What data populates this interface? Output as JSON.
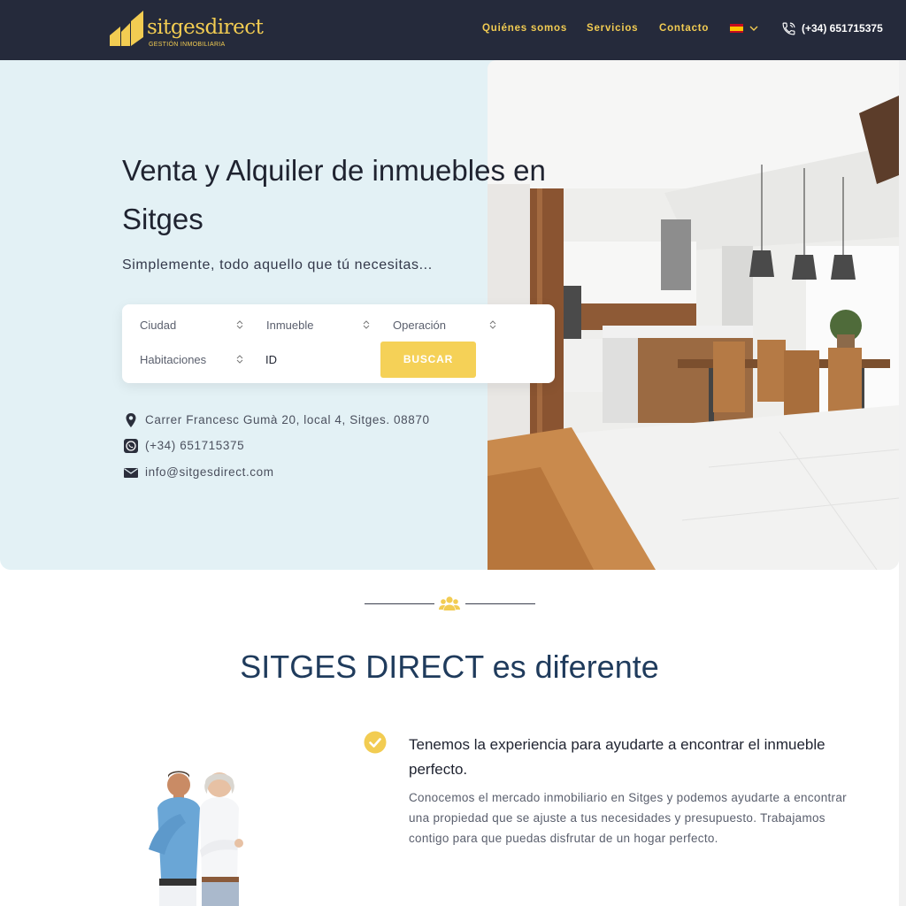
{
  "brand": {
    "name": "sitgesdirect",
    "tagline": "GESTIÓN INMOBILIARIA",
    "accent": "#f2cc52",
    "header_bg": "#252a3b"
  },
  "nav": {
    "items": [
      {
        "label": "Quiénes somos"
      },
      {
        "label": "Servicios"
      },
      {
        "label": "Contacto"
      }
    ],
    "language_icon": "flag-spain-icon",
    "phone": "(+34) 651715375"
  },
  "hero": {
    "title": "Venta y Alquiler de inmuebles en Sitges",
    "subtitle": "Simplemente, todo aquello que tú necesitas...",
    "search": {
      "city": "Ciudad",
      "property": "Inmueble",
      "operation": "Operación",
      "rooms": "Habitaciones",
      "id_placeholder": "ID",
      "button": "BUSCAR"
    },
    "contact": {
      "address": "Carrer Francesc Gumà 20, local 4, Sitges. 08870",
      "phone": "(+34) 651715375",
      "email": "info@sitgesdirect.com"
    }
  },
  "section": {
    "title_strong": "SITGES DIRECT",
    "title_rest": " es diferente",
    "feature": {
      "title": "Tenemos la experiencia para ayudarte a encontrar el inmueble perfecto.",
      "body": "Conocemos el mercado inmobiliario en Sitges y podemos ayudarte a encontrar una propiedad que se ajuste a tus necesidades y presupuesto. Trabajamos contigo para que puedas disfrutar de un hogar perfecto."
    }
  }
}
